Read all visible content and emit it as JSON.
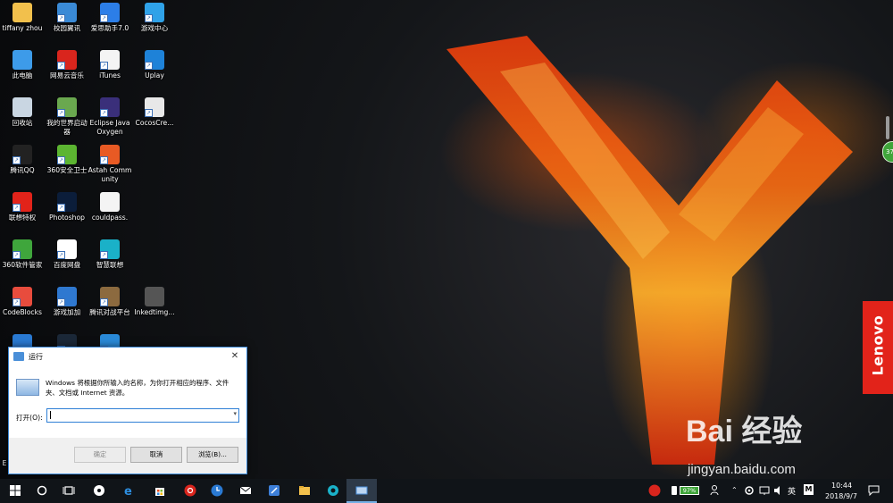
{
  "desktop": {
    "icons": [
      {
        "label": "tiffany zhou",
        "icon": "folder-icon",
        "color": "#f2c04c"
      },
      {
        "label": "校园翼讯",
        "icon": "campus-net-icon",
        "color": "#3a8ad6"
      },
      {
        "label": "爱思助手7.0",
        "icon": "i4-assistant-icon",
        "color": "#2c7ee8"
      },
      {
        "label": "游戏中心",
        "icon": "game-center-icon",
        "color": "#2fa2e8"
      },
      {
        "label": "此电脑",
        "icon": "this-pc-icon",
        "color": "#3d9be9"
      },
      {
        "label": "网易云音乐",
        "icon": "netease-music-icon",
        "color": "#d9251d"
      },
      {
        "label": "iTunes",
        "icon": "itunes-icon",
        "color": "#f4f4f4"
      },
      {
        "label": "Uplay",
        "icon": "uplay-icon",
        "color": "#1e82d8"
      },
      {
        "label": "回收站",
        "icon": "recycle-bin-icon",
        "color": "#c9d6e2"
      },
      {
        "label": "我的世界启动器",
        "icon": "minecraft-launcher-icon",
        "color": "#6aa84f"
      },
      {
        "label": "Eclipse Java Oxygen",
        "icon": "eclipse-icon",
        "color": "#3a2f7a"
      },
      {
        "label": "CocosCre...",
        "icon": "cocos-creator-icon",
        "color": "#e8e8e8"
      },
      {
        "label": "腾讯QQ",
        "icon": "qq-icon",
        "color": "#222222"
      },
      {
        "label": "360安全卫士",
        "icon": "360-security-icon",
        "color": "#5cb531"
      },
      {
        "label": "Astah Community",
        "icon": "astah-icon",
        "color": "#e85a24"
      },
      {
        "label": "",
        "icon": "empty-icon",
        "color": ""
      },
      {
        "label": "联想特权",
        "icon": "lenovo-privilege-icon",
        "color": "#e2231a"
      },
      {
        "label": "Photoshop",
        "icon": "photoshop-icon",
        "color": "#0b1d3a"
      },
      {
        "label": "couldpass.",
        "icon": "document-icon",
        "color": "#f4f4f4"
      },
      {
        "label": "",
        "icon": "empty-icon",
        "color": ""
      },
      {
        "label": "360软件管家",
        "icon": "360-software-icon",
        "color": "#3fa63c"
      },
      {
        "label": "百度网盘",
        "icon": "baidu-netdisk-icon",
        "color": "#ffffff"
      },
      {
        "label": "智慧联想",
        "icon": "smart-lenovo-icon",
        "color": "#1ab1c8"
      },
      {
        "label": "",
        "icon": "empty-icon",
        "color": ""
      },
      {
        "label": "CodeBlocks",
        "icon": "codeblocks-icon",
        "color": "#e84c3d"
      },
      {
        "label": "游戏加加",
        "icon": "game-plus-icon",
        "color": "#2f78d0"
      },
      {
        "label": "腾讯对战平台",
        "icon": "tencent-battle-icon",
        "color": "#8c6a3f"
      },
      {
        "label": "Inkedtimg...",
        "icon": "image-file-icon",
        "color": "#555555"
      },
      {
        "label": "W",
        "icon": "wifi-app-icon",
        "color": "#2a7ad3"
      },
      {
        "label": "",
        "icon": "steam-icon",
        "color": "#1b2838"
      },
      {
        "label": "",
        "icon": "globe-app-icon",
        "color": "#2a8ad8"
      }
    ],
    "partial_label": "E"
  },
  "run_dialog": {
    "title": "运行",
    "close": "✕",
    "description": "Windows 将根据你所输入的名称，为你打开相应的程序、文件夹、文档或 Internet 资源。",
    "open_label": "打开(O):",
    "open_value": "",
    "dropdown": "▾",
    "ok_label": "确定",
    "cancel_label": "取消",
    "browse_label": "浏览(B)..."
  },
  "lenovo": {
    "text": "Lenovo",
    "color": "#e2231a"
  },
  "side_badge": "37",
  "watermark": {
    "main": "Bai 经验",
    "url": "jingyan.baidu.com"
  },
  "taskbar": {
    "apps": [
      "start-icon",
      "cortana-icon",
      "task-view-icon",
      "fan-app-icon",
      "edge-icon",
      "store-icon",
      "netease-taskbar-icon",
      "clock-app-icon",
      "mail-icon",
      "feather-app-icon",
      "file-explorer-icon",
      "teal-app-icon",
      "run-taskbar-icon"
    ],
    "battery": "97%",
    "ime": "英",
    "ime_mode": "M",
    "time": "10:44",
    "date": "2018/9/7"
  }
}
